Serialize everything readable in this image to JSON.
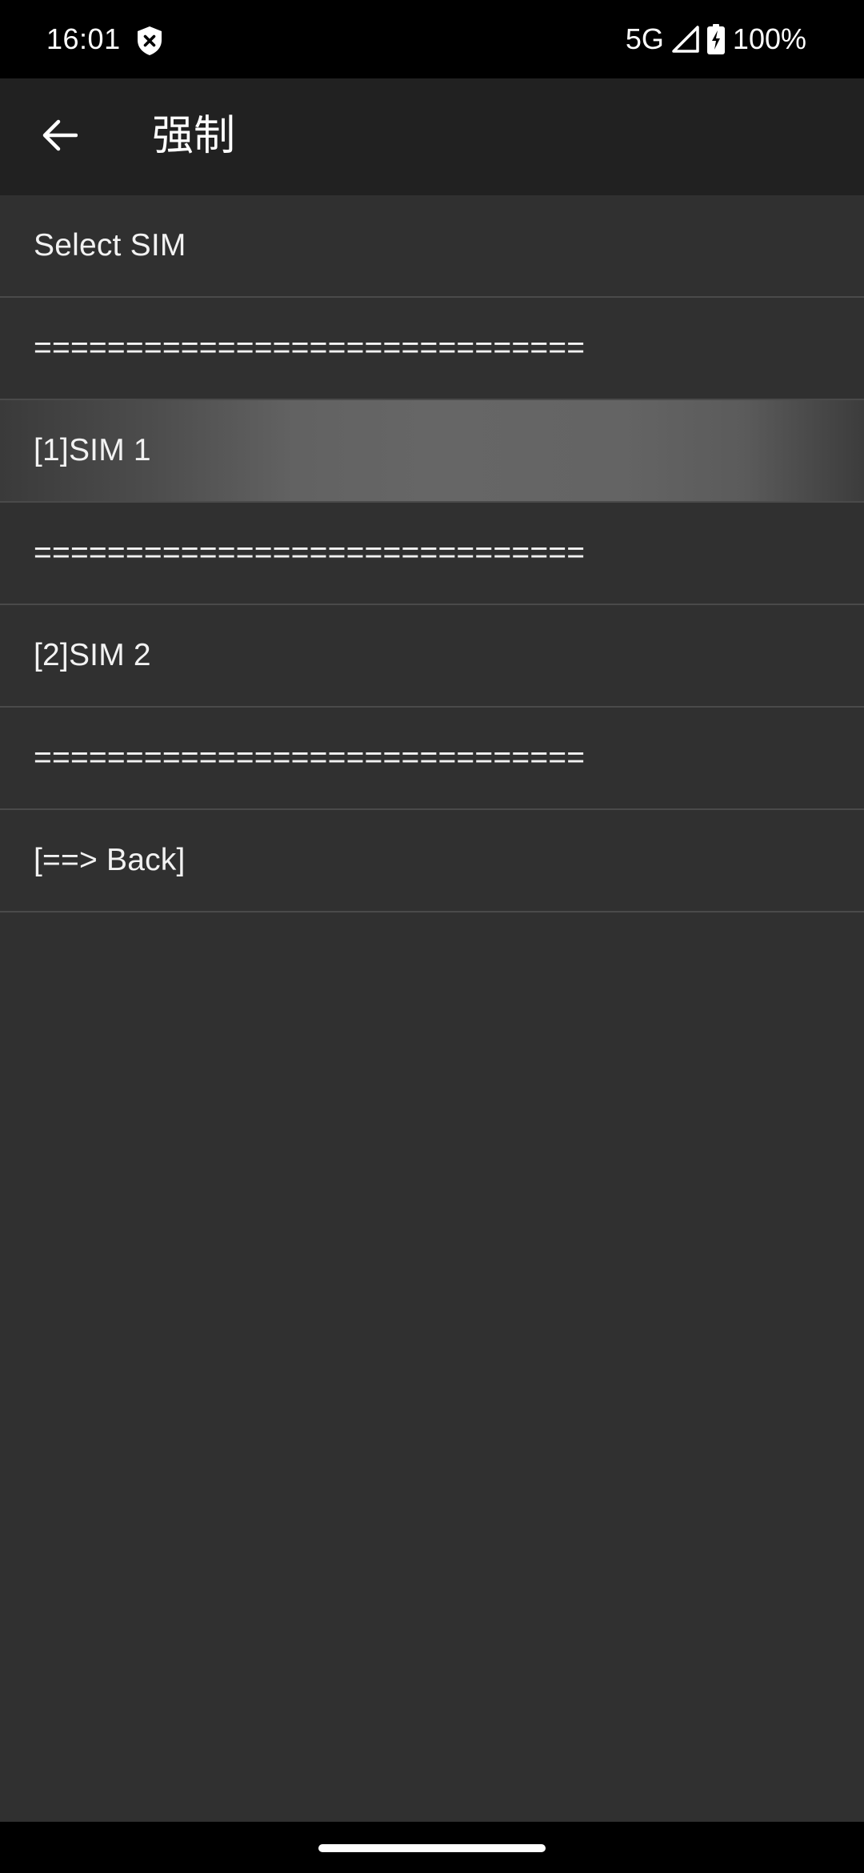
{
  "status_bar": {
    "time": "16:01",
    "network": "5G",
    "battery": "100%",
    "icons": [
      "shield-x-icon",
      "signal-icon",
      "battery-charging-icon"
    ]
  },
  "app_bar": {
    "title": "强制",
    "back_icon": "arrow-back-icon"
  },
  "menu": {
    "items": [
      {
        "label": "Select SIM"
      },
      {
        "label": "=============================="
      },
      {
        "label": "[1]SIM 1",
        "pressed": true
      },
      {
        "label": "=============================="
      },
      {
        "label": "[2]SIM 2"
      },
      {
        "label": "=============================="
      },
      {
        "label": "[==> Back]"
      }
    ]
  },
  "colors": {
    "background": "#303030",
    "app_bar": "#212121",
    "status_bar": "#000000",
    "divider": "#4a4a4a",
    "text": "#f2f2f2"
  }
}
